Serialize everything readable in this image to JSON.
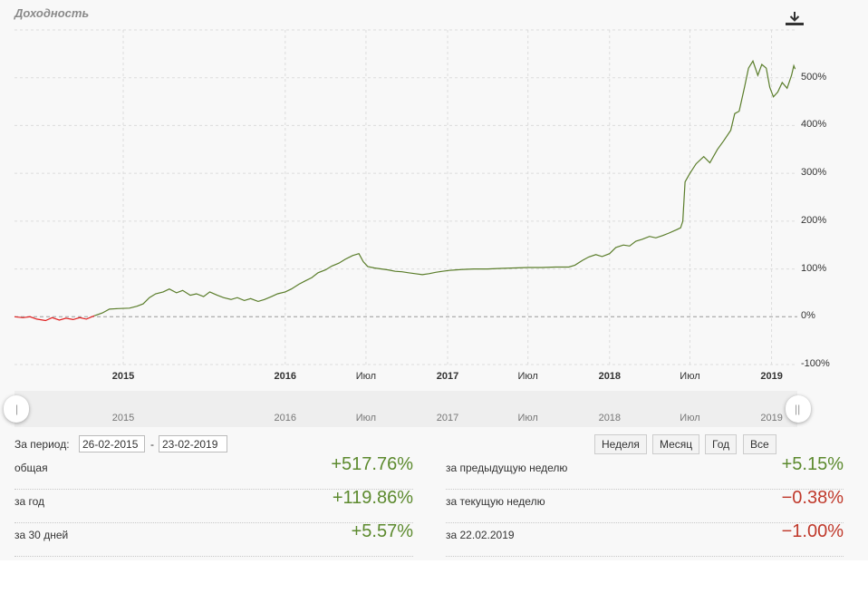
{
  "title": "Доходность",
  "icons": {
    "download": "download-icon"
  },
  "colors": {
    "positive": "#5c8a2e",
    "negative": "#c0392b",
    "line": "#5a7d2a",
    "line_negative": "#e02020"
  },
  "chart_data": {
    "type": "line",
    "title": "Доходность",
    "x_domain": [
      "2014-05-01",
      "2019-02-28"
    ],
    "y_range": [
      -100,
      600
    ],
    "y_ticks": [
      {
        "value": 500,
        "label": "500%"
      },
      {
        "value": 400,
        "label": "400%"
      },
      {
        "value": 300,
        "label": "300%"
      },
      {
        "value": 200,
        "label": "200%"
      },
      {
        "value": 100,
        "label": "100%"
      },
      {
        "value": 0,
        "label": "0%"
      },
      {
        "value": -100,
        "label": "-100%"
      }
    ],
    "x_ticks": [
      {
        "date": "2015-01-01",
        "label": "2015",
        "major": true
      },
      {
        "date": "2016-01-01",
        "label": "2016",
        "major": true
      },
      {
        "date": "2016-07-01",
        "label": "Июл",
        "major": false
      },
      {
        "date": "2017-01-01",
        "label": "2017",
        "major": true
      },
      {
        "date": "2017-07-01",
        "label": "Июл",
        "major": false
      },
      {
        "date": "2018-01-01",
        "label": "2018",
        "major": true
      },
      {
        "date": "2018-07-01",
        "label": "Июл",
        "major": false
      },
      {
        "date": "2019-01-01",
        "label": "2019",
        "major": true
      }
    ],
    "grid": true,
    "zero_line": "dashed",
    "series": [
      {
        "color": "#e02020",
        "points": [
          [
            "2014-05-01",
            0
          ],
          [
            "2014-05-20",
            -2
          ],
          [
            "2014-06-05",
            0
          ],
          [
            "2014-06-20",
            -5
          ],
          [
            "2014-07-10",
            -8
          ],
          [
            "2014-07-25",
            -2
          ],
          [
            "2014-08-10",
            -7
          ],
          [
            "2014-08-25",
            -3
          ],
          [
            "2014-09-10",
            -6
          ],
          [
            "2014-09-25",
            -2
          ],
          [
            "2014-10-10",
            -5
          ],
          [
            "2014-10-20",
            -1
          ],
          [
            "2014-10-28",
            2
          ]
        ]
      },
      {
        "color": "#5a7d2a",
        "points": [
          [
            "2014-10-28",
            2
          ],
          [
            "2014-11-15",
            8
          ],
          [
            "2014-12-01",
            16
          ],
          [
            "2014-12-20",
            17
          ],
          [
            "2015-01-15",
            18
          ],
          [
            "2015-02-01",
            22
          ],
          [
            "2015-02-15",
            27
          ],
          [
            "2015-03-01",
            40
          ],
          [
            "2015-03-15",
            48
          ],
          [
            "2015-04-01",
            52
          ],
          [
            "2015-04-15",
            58
          ],
          [
            "2015-05-01",
            50
          ],
          [
            "2015-05-15",
            55
          ],
          [
            "2015-06-01",
            45
          ],
          [
            "2015-06-15",
            48
          ],
          [
            "2015-07-01",
            42
          ],
          [
            "2015-07-15",
            52
          ],
          [
            "2015-08-01",
            45
          ],
          [
            "2015-08-15",
            40
          ],
          [
            "2015-09-01",
            36
          ],
          [
            "2015-09-15",
            40
          ],
          [
            "2015-10-01",
            34
          ],
          [
            "2015-10-15",
            38
          ],
          [
            "2015-11-01",
            32
          ],
          [
            "2015-11-15",
            36
          ],
          [
            "2015-12-01",
            42
          ],
          [
            "2015-12-15",
            48
          ],
          [
            "2016-01-01",
            52
          ],
          [
            "2016-01-15",
            58
          ],
          [
            "2016-02-01",
            68
          ],
          [
            "2016-02-15",
            75
          ],
          [
            "2016-03-01",
            82
          ],
          [
            "2016-03-15",
            92
          ],
          [
            "2016-04-01",
            98
          ],
          [
            "2016-04-15",
            106
          ],
          [
            "2016-05-01",
            112
          ],
          [
            "2016-05-15",
            120
          ],
          [
            "2016-06-01",
            128
          ],
          [
            "2016-06-15",
            132
          ],
          [
            "2016-06-25",
            115
          ],
          [
            "2016-07-05",
            105
          ],
          [
            "2016-07-20",
            102
          ],
          [
            "2016-08-05",
            100
          ],
          [
            "2016-08-20",
            98
          ],
          [
            "2016-09-05",
            95
          ],
          [
            "2016-09-20",
            94
          ],
          [
            "2016-10-05",
            92
          ],
          [
            "2016-10-20",
            90
          ],
          [
            "2016-11-05",
            88
          ],
          [
            "2016-11-20",
            90
          ],
          [
            "2016-12-05",
            93
          ],
          [
            "2016-12-20",
            95
          ],
          [
            "2017-01-05",
            97
          ],
          [
            "2017-01-20",
            98
          ],
          [
            "2017-02-05",
            99
          ],
          [
            "2017-03-01",
            100
          ],
          [
            "2017-04-01",
            100
          ],
          [
            "2017-05-01",
            101
          ],
          [
            "2017-06-01",
            102
          ],
          [
            "2017-07-01",
            103
          ],
          [
            "2017-08-01",
            103
          ],
          [
            "2017-09-01",
            104
          ],
          [
            "2017-10-01",
            104
          ],
          [
            "2017-10-15",
            108
          ],
          [
            "2017-11-01",
            118
          ],
          [
            "2017-11-15",
            125
          ],
          [
            "2017-12-01",
            130
          ],
          [
            "2017-12-15",
            126
          ],
          [
            "2018-01-01",
            132
          ],
          [
            "2018-01-15",
            145
          ],
          [
            "2018-02-01",
            150
          ],
          [
            "2018-02-15",
            148
          ],
          [
            "2018-03-01",
            158
          ],
          [
            "2018-03-15",
            162
          ],
          [
            "2018-04-01",
            168
          ],
          [
            "2018-04-15",
            165
          ],
          [
            "2018-05-01",
            170
          ],
          [
            "2018-05-15",
            175
          ],
          [
            "2018-06-01",
            182
          ],
          [
            "2018-06-10",
            186
          ],
          [
            "2018-06-15",
            200
          ],
          [
            "2018-06-20",
            282
          ],
          [
            "2018-07-01",
            300
          ],
          [
            "2018-07-15",
            320
          ],
          [
            "2018-08-01",
            335
          ],
          [
            "2018-08-15",
            322
          ],
          [
            "2018-09-01",
            350
          ],
          [
            "2018-09-15",
            368
          ],
          [
            "2018-10-01",
            390
          ],
          [
            "2018-10-10",
            425
          ],
          [
            "2018-10-20",
            430
          ],
          [
            "2018-11-01",
            480
          ],
          [
            "2018-11-10",
            520
          ],
          [
            "2018-11-20",
            535
          ],
          [
            "2018-12-01",
            505
          ],
          [
            "2018-12-10",
            528
          ],
          [
            "2018-12-20",
            520
          ],
          [
            "2018-12-28",
            480
          ],
          [
            "2019-01-05",
            460
          ],
          [
            "2019-01-15",
            470
          ],
          [
            "2019-01-25",
            490
          ],
          [
            "2019-02-05",
            478
          ],
          [
            "2019-02-15",
            505
          ],
          [
            "2019-02-20",
            525
          ],
          [
            "2019-02-23",
            518
          ]
        ]
      }
    ]
  },
  "navigator": {
    "labels": [
      {
        "date": "2015-01-01",
        "label": "2015"
      },
      {
        "date": "2016-01-01",
        "label": "2016"
      },
      {
        "date": "2016-07-01",
        "label": "Июл"
      },
      {
        "date": "2017-01-01",
        "label": "2017"
      },
      {
        "date": "2017-07-01",
        "label": "Июл"
      },
      {
        "date": "2018-01-01",
        "label": "2018"
      },
      {
        "date": "2018-07-01",
        "label": "Июл"
      },
      {
        "date": "2019-01-01",
        "label": "2019"
      }
    ]
  },
  "period": {
    "label": "За период:",
    "from": "26-02-2015",
    "separator": "-",
    "to": "23-02-2019"
  },
  "range_buttons": [
    "Неделя",
    "Месяц",
    "Год",
    "Все"
  ],
  "stats_left": [
    {
      "label": "общая",
      "value": "+517.76%",
      "sign": "pos"
    },
    {
      "label": "за год",
      "value": "+119.86%",
      "sign": "pos"
    },
    {
      "label": "за 30 дней",
      "value": "+5.57%",
      "sign": "pos"
    }
  ],
  "stats_right": [
    {
      "label": "за предыдущую неделю",
      "value": "+5.15%",
      "sign": "pos"
    },
    {
      "label": "за текущую неделю",
      "value": "−0.38%",
      "sign": "neg"
    },
    {
      "label": "за 22.02.2019",
      "value": "−1.00%",
      "sign": "neg"
    }
  ]
}
